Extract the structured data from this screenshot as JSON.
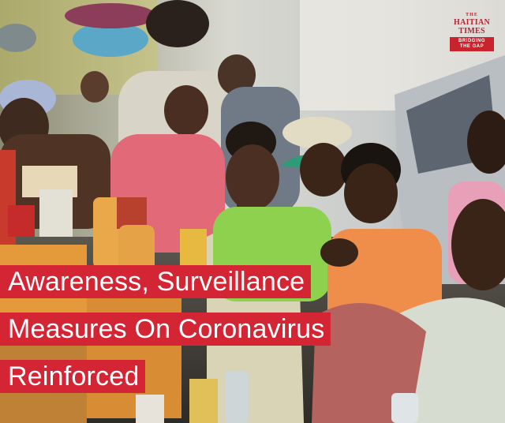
{
  "logo": {
    "the": "THE",
    "name_line1": "HAITIAN",
    "name_line2": "TIMES",
    "tagline_line1": "BRIDGING",
    "tagline_line2": "THE GAP"
  },
  "headline": {
    "line1": "Awareness, Surveillance",
    "line2": "Measures On Coronavirus",
    "line3": "Reinforced"
  },
  "colors": {
    "banner_red": "#d42535",
    "logo_red": "#b52430",
    "headline_text": "#ffffff"
  }
}
